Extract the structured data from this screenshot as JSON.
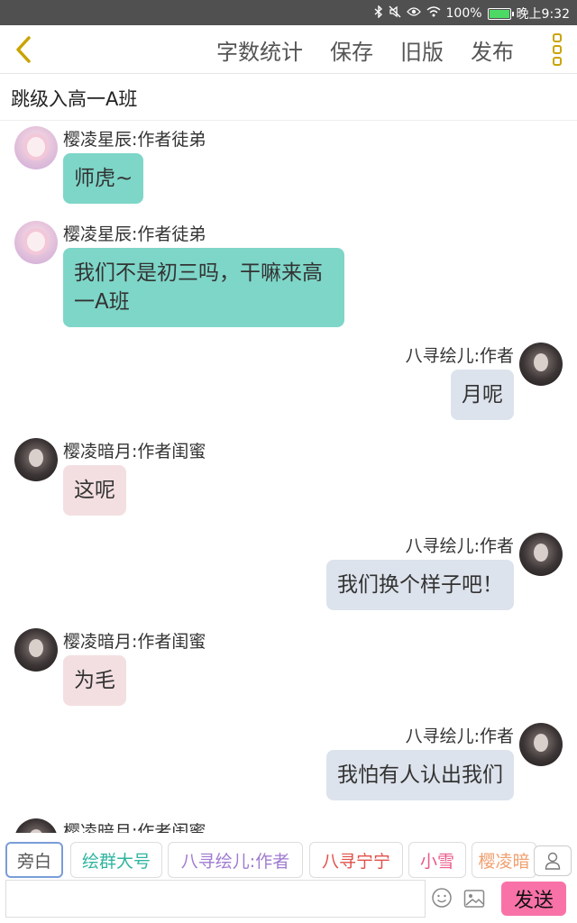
{
  "status_bar": {
    "battery_text": "100%",
    "time": "晚上9:32",
    "battery_level": 1.0,
    "icons": [
      "bluetooth-icon",
      "mute-icon",
      "eye-icon",
      "wifi-icon",
      "battery-icon"
    ]
  },
  "toolbar": {
    "back_icon": "chevron-left-icon",
    "actions": [
      "字数统计",
      "保存",
      "旧版",
      "发布"
    ],
    "more_icon": "more-vertical-icon",
    "accent_color": "#c9a400"
  },
  "chapter_title": "跳级入高一A班",
  "messages": [
    {
      "side": "left",
      "avatar": "avatar-pink",
      "name": "樱凌星辰:作者徒弟",
      "text": "师虎~",
      "bubble_color": "#7ed6c8"
    },
    {
      "side": "left",
      "avatar": "avatar-pink",
      "name": "樱凌星辰:作者徒弟",
      "text": "我们不是初三吗，干嘛来高一A班",
      "bubble_color": "#7ed6c8"
    },
    {
      "side": "right",
      "avatar": "avatar-dark",
      "name": "八寻绘儿:作者",
      "text": "月呢",
      "bubble_color": "#dde3ec"
    },
    {
      "side": "left",
      "avatar": "avatar-dark",
      "name": "樱凌暗月:作者闺蜜",
      "text": "这呢",
      "bubble_color": "#f3dfe1"
    },
    {
      "side": "right",
      "avatar": "avatar-dark",
      "name": "八寻绘儿:作者",
      "text": "我们换个样子吧！",
      "bubble_color": "#dde3ec"
    },
    {
      "side": "left",
      "avatar": "avatar-dark",
      "name": "樱凌暗月:作者闺蜜",
      "text": "为毛",
      "bubble_color": "#f3dfe1"
    },
    {
      "side": "right",
      "avatar": "avatar-dark",
      "name": "八寻绘儿:作者",
      "text": "我怕有人认出我们",
      "bubble_color": "#dde3ec"
    },
    {
      "side": "left",
      "avatar": "avatar-dark",
      "name": "樱凌暗月:作者闺蜜",
      "text": "",
      "bubble_color": "#f3dfe1"
    }
  ],
  "role_chips": [
    {
      "label": "旁白",
      "color": "#555555",
      "selected": true
    },
    {
      "label": "绘群大号",
      "color": "#2fb5a0",
      "selected": false
    },
    {
      "label": "八寻绘儿:作者",
      "color": "#a07bd0",
      "selected": false
    },
    {
      "label": "八寻宁宁",
      "color": "#e0504a",
      "selected": false
    },
    {
      "label": "小雪",
      "color": "#e85a8a",
      "selected": false
    },
    {
      "label": "樱凌暗",
      "color": "#f0a070",
      "selected": false
    }
  ],
  "composer": {
    "placeholder": "",
    "send_label": "发送",
    "send_color": "#f872a8",
    "emoji_icon": "smiley-icon",
    "image_icon": "image-icon",
    "user_icon": "user-icon"
  }
}
